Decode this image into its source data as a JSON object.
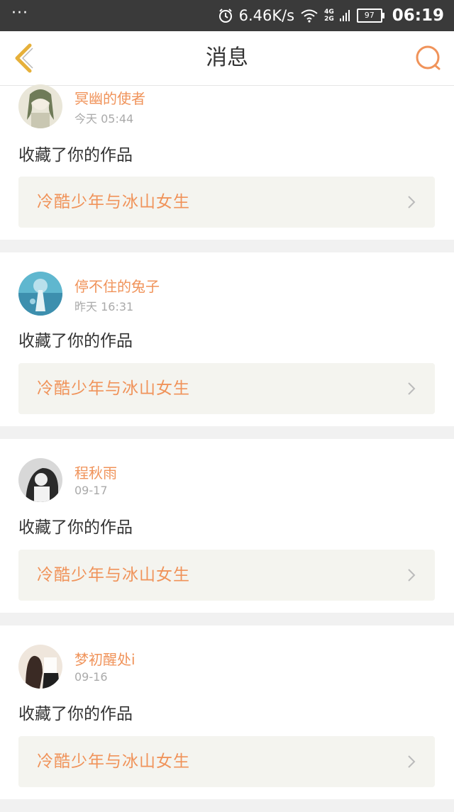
{
  "status_bar": {
    "dots": "···",
    "speed": "6.46K/s",
    "network": [
      "4G",
      "2G"
    ],
    "battery": "97",
    "time": "06:19"
  },
  "header": {
    "title": "消息",
    "back_icon": "chevron-left-icon",
    "search_icon": "search-icon"
  },
  "colors": {
    "accent": "#f0935a",
    "back": "#e6b03a",
    "card_link_bg": "#f4f4ef"
  },
  "messages": [
    {
      "user": "冥幽的使者",
      "time": "今天  05:44",
      "action": "收藏了你的作品",
      "work": "冷酷少年与冰山女生"
    },
    {
      "user": "停不住的兔子",
      "time": "昨天  16:31",
      "action": "收藏了你的作品",
      "work": "冷酷少年与冰山女生"
    },
    {
      "user": "程秋雨",
      "time": "09-17",
      "action": "收藏了你的作品",
      "work": "冷酷少年与冰山女生"
    },
    {
      "user": "梦初醒处i",
      "time": "09-16",
      "action": "收藏了你的作品",
      "work": "冷酷少年与冰山女生"
    }
  ]
}
